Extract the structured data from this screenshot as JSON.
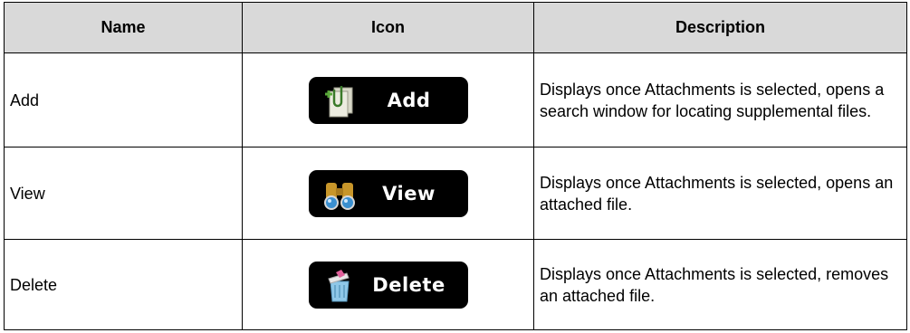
{
  "headers": {
    "name": "Name",
    "icon": "Icon",
    "description": "Description"
  },
  "rows": [
    {
      "name": "Add",
      "button_label": "Add",
      "icon": "paperclip-document-icon",
      "description": "Displays once Attachments is selected, opens a search window for locating supplemental files."
    },
    {
      "name": "View",
      "button_label": "View",
      "icon": "binoculars-icon",
      "description": "Displays once Attachments is selected, opens an attached file."
    },
    {
      "name": "Delete",
      "button_label": "Delete",
      "icon": "trash-can-icon",
      "description": "Displays once Attachments is selected, removes an attached file."
    }
  ],
  "colors": {
    "header_background": "#d9d9d9",
    "button_background": "#000000",
    "button_text": "#ffffff"
  }
}
